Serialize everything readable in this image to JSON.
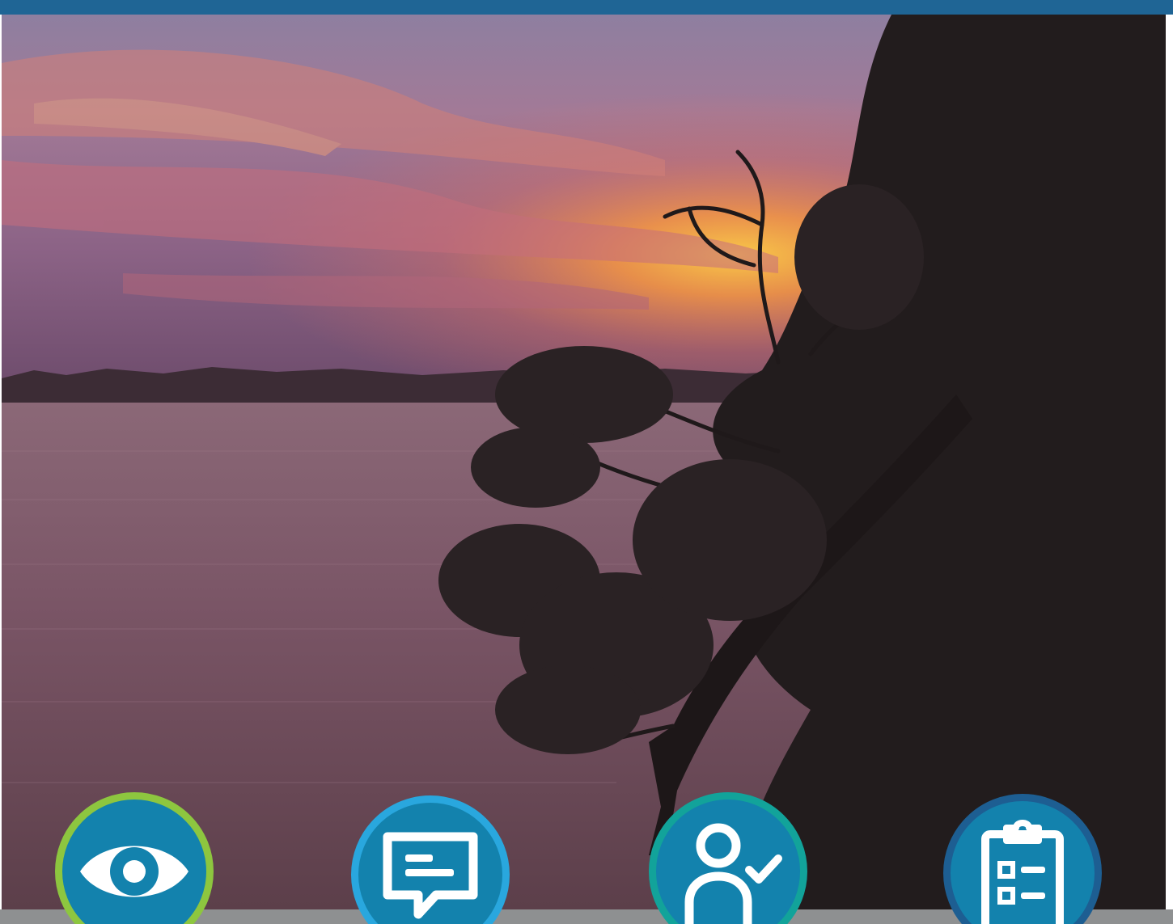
{
  "colors": {
    "top_bar": "#1f6595",
    "badge_fill": "#1382ad",
    "bottom_strip": "#8e9091",
    "sky_top": "#7b6c8e",
    "sunset_orange": "#ff8f3e",
    "water": "#7a5566",
    "tree_silhouette": "#201b1c"
  },
  "badges": [
    {
      "icon": "eye-icon",
      "ring_color": "#8dc63f"
    },
    {
      "icon": "chat-message-icon",
      "ring_color": "#29a7de"
    },
    {
      "icon": "user-check-icon",
      "ring_color": "#12a39a"
    },
    {
      "icon": "clipboard-checklist-icon",
      "ring_color": "#1d5e92"
    }
  ]
}
